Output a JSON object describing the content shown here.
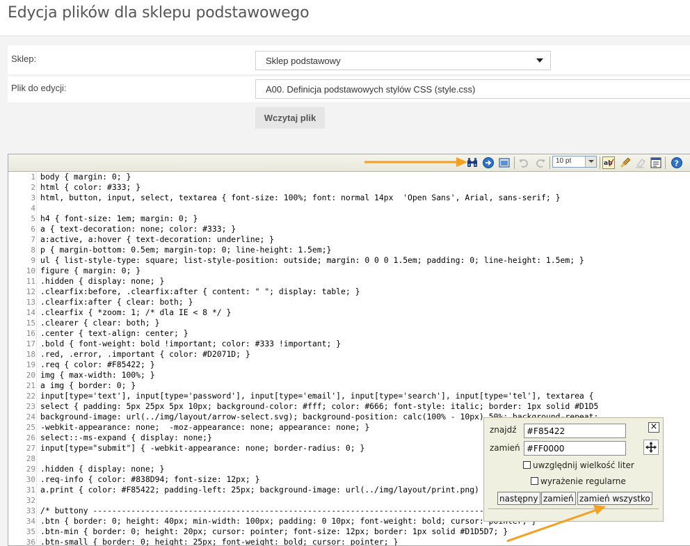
{
  "page": {
    "title": "Edycja plików dla sklepu podstawowego"
  },
  "form": {
    "shop_label": "Sklep:",
    "shop_value": "Sklep podstawowy",
    "file_label": "Plik do edycji:",
    "file_value": "A00. Definicja podstawowych stylów CSS (style.css)",
    "load_button": "Wczytaj plik"
  },
  "toolbar": {
    "font_size": "10 pt",
    "icons": [
      "search-replace-icon",
      "goto-line-icon",
      "fullscreen-icon",
      "undo-icon",
      "redo-icon",
      "syntax-highlight-icon",
      "reset-highlight-icon",
      "toggle-editor-icon",
      "word-wrap-icon",
      "help-icon"
    ]
  },
  "code": {
    "lines": [
      {
        "n": "1",
        "text": "body { margin: 0; }"
      },
      {
        "n": "2",
        "text": "html { color: #333; }"
      },
      {
        "n": "3",
        "text": "html, button, input, select, textarea { font-size: 100%; font: normal 14px  'Open Sans', Arial, sans-serif; }"
      },
      {
        "n": "4",
        "text": ""
      },
      {
        "n": "5",
        "text": "h4 { font-size: 1em; margin: 0; }"
      },
      {
        "n": "6",
        "text": "a { text-decoration: none; color: #333; }"
      },
      {
        "n": "7",
        "text": "a:active, a:hover { text-decoration: underline; }"
      },
      {
        "n": "8",
        "text": "p { margin-bottom: 0.5em; margin-top: 0; line-height: 1.5em;}"
      },
      {
        "n": "9",
        "text": "ul { list-style-type: square; list-style-position: outside; margin: 0 0 0 1.5em; padding: 0; line-height: 1.5em; }"
      },
      {
        "n": "10",
        "text": "figure { margin: 0; }"
      },
      {
        "n": "11",
        "text": ".hidden { display: none; }"
      },
      {
        "n": "12",
        "text": ".clearfix:before, .clearfix:after { content: \" \"; display: table; }"
      },
      {
        "n": "13",
        "text": ".clearfix:after { clear: both; }"
      },
      {
        "n": "14",
        "text": ".clearfix { *zoom: 1; /* dla IE < 8 */ }"
      },
      {
        "n": "15",
        "text": ".clearer { clear: both; }"
      },
      {
        "n": "16",
        "text": ".center { text-align: center; }"
      },
      {
        "n": "17",
        "text": ".bold { font-weight: bold !important; color: #333 !important; }"
      },
      {
        "n": "18",
        "text": ".red, .error, .important { color: #D2071D; }"
      },
      {
        "n": "19",
        "text": ".req { color: #F85422; }"
      },
      {
        "n": "20",
        "text": "img { max-width: 100%; }"
      },
      {
        "n": "21",
        "text": "a img { border: 0; }"
      },
      {
        "n": "22",
        "text": "input[type='text'], input[type='password'], input[type='email'], input[type='search'], input[type='tel'], textarea {"
      },
      {
        "n": "23",
        "text": "select { padding: 5px 25px 5px 10px; background-color: #fff; color: #666; font-style: italic; border: 1px solid #D1D5"
      },
      {
        "n": "24",
        "text": "background-image: url(../img/layout/arrow-select.svg); background-position: calc(100% - 10px) 50%; background-repeat:"
      },
      {
        "n": "25",
        "text": "-webkit-appearance: none;  -moz-appearance: none; appearance: none; }"
      },
      {
        "n": "26",
        "text": "select::-ms-expand { display: none;}"
      },
      {
        "n": "27",
        "text": "input[type=\"submit\"] { -webkit-appearance: none; border-radius: 0; }"
      },
      {
        "n": "28",
        "text": ""
      },
      {
        "n": "29",
        "text": ".hidden { display: none; }"
      },
      {
        "n": "30",
        "text": ".req-info { color: #838D94; font-size: 12px; }"
      },
      {
        "n": "31",
        "text": "a.print { color: #F85422; padding-left: 25px; background-image: url(../img/layout/print.png) no-repeat left center; position"
      },
      {
        "n": "32",
        "text": ""
      },
      {
        "n": "33",
        "text": "/* buttony ----------------------------------------------------------------------------------------------------- */"
      },
      {
        "n": "34",
        "text": ".btn { border: 0; height: 40px; min-width: 100px; padding: 0 10px; font-weight: bold; cursor: pointer; }"
      },
      {
        "n": "35",
        "text": ".btn-min { border: 0; height: 20px; cursor: pointer; font-size: 12px; border: 1px solid #D1D5D7; }"
      },
      {
        "n": "36",
        "text": ".btn-small { border: 0; height: 25px; font-weight: bold; cursor: pointer; }"
      }
    ]
  },
  "search_dialog": {
    "find_label": "znajdź",
    "find_value": "#F85422",
    "replace_label": "zamień",
    "replace_value": "#FF0000",
    "case_label": "uwzględnij wielkość liter",
    "regex_label": "wyrażenie regularne",
    "next_button": "następny",
    "replace_button": "zamień",
    "replace_all_button": "zamień wszystko"
  },
  "colors": {
    "annotation_arrow": "#f5a020",
    "accent": "#F85422"
  }
}
